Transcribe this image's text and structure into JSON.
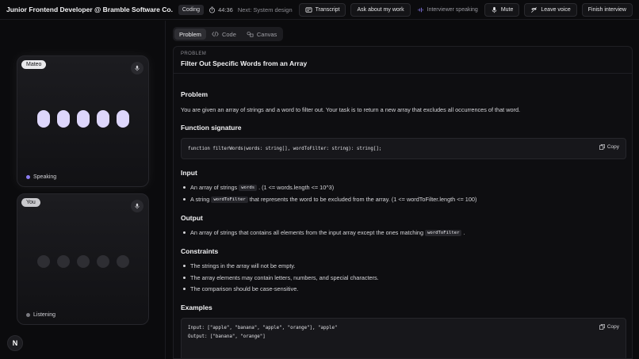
{
  "header": {
    "title": "Junior Frontend Developer @ Bramble Software Co.",
    "mode_badge": "Coding",
    "timer": "44:36",
    "next": "Next: System design",
    "transcript": "Transcript",
    "ask": "Ask about my work",
    "speaking": "Interviewer speaking",
    "mute": "Mute",
    "leave": "Leave voice",
    "finish": "Finish interview"
  },
  "participants": {
    "interviewer": {
      "name": "Mateo",
      "status": "Speaking",
      "status_color": "#8b7cf0"
    },
    "candidate": {
      "name": "You",
      "status": "Listening",
      "status_color": "#7a7a80"
    }
  },
  "logo": "N",
  "tabs": [
    {
      "label": "Problem",
      "active": true
    },
    {
      "label": "Code",
      "active": false
    },
    {
      "label": "Canvas",
      "active": false
    }
  ],
  "problem": {
    "label": "PROBLEM",
    "title": "Filter Out Specific Words from an Array",
    "problem_heading": "Problem",
    "problem_text": "You are given an array of strings and a word to filter out. Your task is to return a new array that excludes all occurrences of that word.",
    "signature_heading": "Function signature",
    "signature_code": "function filterWords(words: string[], wordToFilter: string): string[];",
    "copy_label": "Copy",
    "input_heading": "Input",
    "input_items": [
      {
        "pre": "An array of strings",
        "code": "words",
        "post": ". (1 <= words.length <= 10^3)"
      },
      {
        "pre": "A string",
        "code": "wordToFilter",
        "post": "that represents the word to be excluded from the array. (1 <= wordToFilter.length <= 100)"
      }
    ],
    "output_heading": "Output",
    "output_item": {
      "pre": "An array of strings that contains all elements from the input array except the ones matching",
      "code": "wordToFilter",
      "post": "."
    },
    "constraints_heading": "Constraints",
    "constraints": [
      "The strings in the array will not be empty.",
      "The array elements may contain letters, numbers, and special characters.",
      "The comparison should be case-sensitive."
    ],
    "examples_heading": "Examples",
    "example_lines": [
      "Input: [\"apple\", \"banana\", \"apple\", \"orange\"], \"apple\"",
      "Output: [\"banana\", \"orange\"]"
    ]
  },
  "colors": {
    "accent_dot": "#ddd6fb",
    "background": "#0b0b0d"
  }
}
